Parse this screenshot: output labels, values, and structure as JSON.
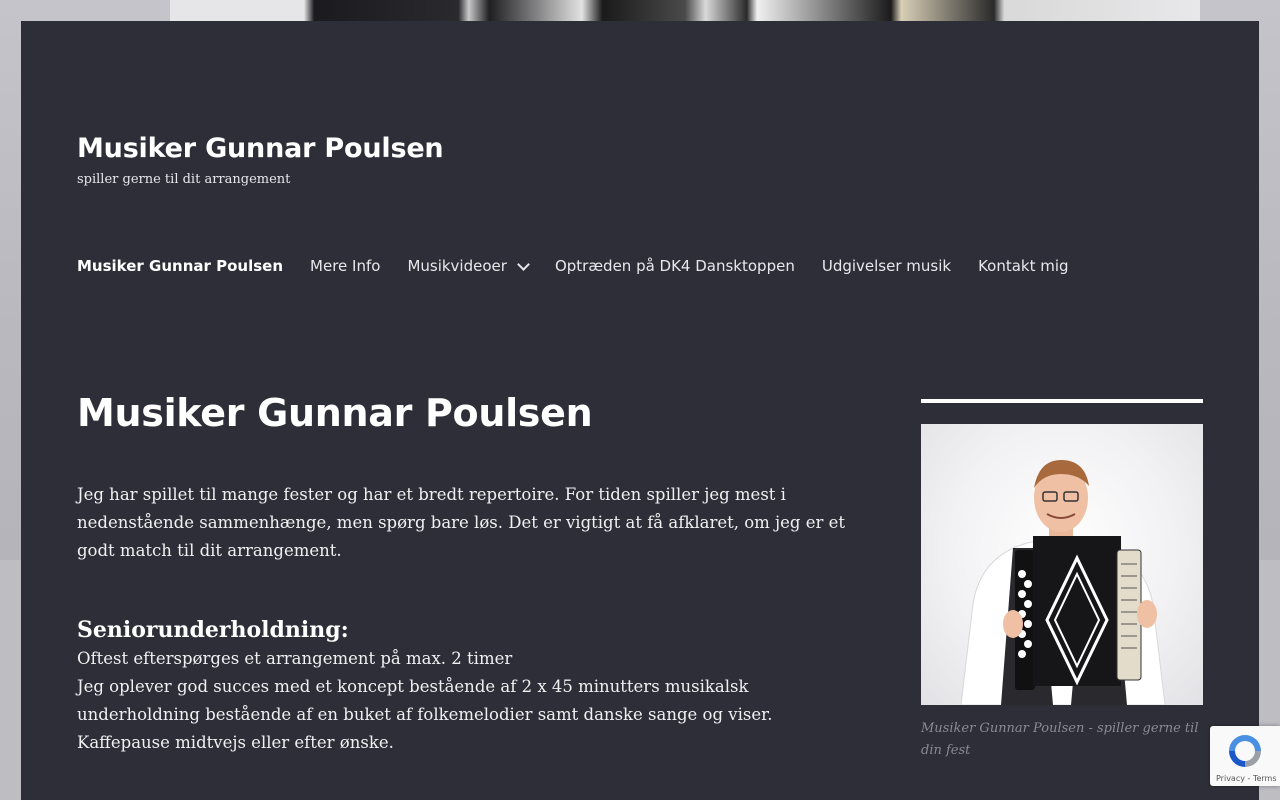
{
  "header": {
    "site_title": "Musiker Gunnar Poulsen",
    "site_description": "spiller gerne til dit arrangement"
  },
  "nav": {
    "items": [
      {
        "label": "Musiker Gunnar Poulsen",
        "current": true
      },
      {
        "label": "Mere Info"
      },
      {
        "label": "Musikvideoer",
        "has_submenu": true,
        "icon": "chevron-down-icon"
      },
      {
        "label": "Optræden på DK4 Dansktoppen"
      },
      {
        "label": "Udgivelser musik"
      },
      {
        "label": "Kontakt mig"
      }
    ]
  },
  "page": {
    "title": "Musiker Gunnar Poulsen",
    "intro": "Jeg har spillet til mange fester og har et bredt repertoire. For tiden spiller jeg mest i nedenstående sammenhænge, men spørg bare løs. Det er vigtigt at få afklaret, om jeg er et godt match til dit arrangement.",
    "section_heading": "Seniorunderholdning:",
    "section_line1": "Oftest efterspørges et arrangement på max. 2 timer",
    "section_line2": "Jeg oplever god succes med et koncept bestående af 2 x 45 minutters musikalsk underholdning bestående af en buket af folkemelodier samt danske sange og viser. Kaffepause midtvejs eller efter ønske."
  },
  "sidebar": {
    "image_caption": "Musiker Gunnar Poulsen - spiller gerne til din fest"
  },
  "recaptcha": {
    "links": "Privacy - Terms"
  },
  "colors": {
    "site_background": "#2e2e38",
    "text": "#ffffff",
    "caption": "#8a8a94"
  }
}
